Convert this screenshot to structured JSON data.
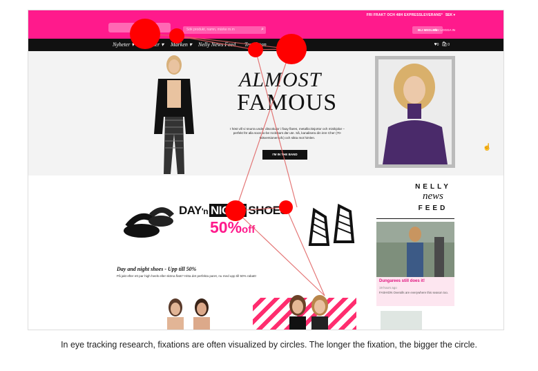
{
  "topbar": {
    "promo_text": "FRI FRAKT OCH 48H EXPRESSLEVERANS*",
    "currency": "SEK ▾",
    "search_placeholder": "Sök produkt, namn, märke m.m",
    "register_label": "BLI MEDLEM",
    "login_text": "eller LOGGA IN"
  },
  "nav": {
    "items": [
      "Nyheter ▾",
      "Kläder ▾",
      "Märken ▾",
      "Nelly News Feed",
      "Trendstan"
    ],
    "cart_count": "0",
    "wish_count": "0"
  },
  "hero": {
    "headline_1": "ALMOST",
    "headline_2": "FAMOUS",
    "copy": "I höst vill vi snurra under discokulor i fixay flares, metalliccksjortor och minikjolar – perfekt för alla soon-to-be rockstars där ute. Så, kanalisera din inre Cher (70-talsversionen ofc) och sikta mot himlen.",
    "cta_label": "I'M IN THE BAND"
  },
  "promo": {
    "title_day": "DAY",
    "title_n": "'n",
    "title_night": "NIGHT",
    "title_shoes": "SHOES",
    "percent": "50%",
    "off": "off",
    "heading": "Day and night shoes - Upp till 50%",
    "body": "På jakt efter ett par high heels eller sköna flats? Hitta det perfekta paret, nu med upp till 50% rabatt!"
  },
  "feed": {
    "brand_1": "NELLY",
    "brand_2": "news",
    "brand_3": "FEED",
    "post_title": "Dungarees still does it!",
    "post_time": "19 hours ago",
    "post_desc": "FASHION Overalls are everywhere this season too."
  },
  "caption": "In eye tracking research, fixations are often visualized by circles. The longer the fixation, the bigger the circle.",
  "colors": {
    "brand_pink": "#ff1a8c",
    "nav_black": "#111111",
    "fixation_red": "#ff0000"
  }
}
